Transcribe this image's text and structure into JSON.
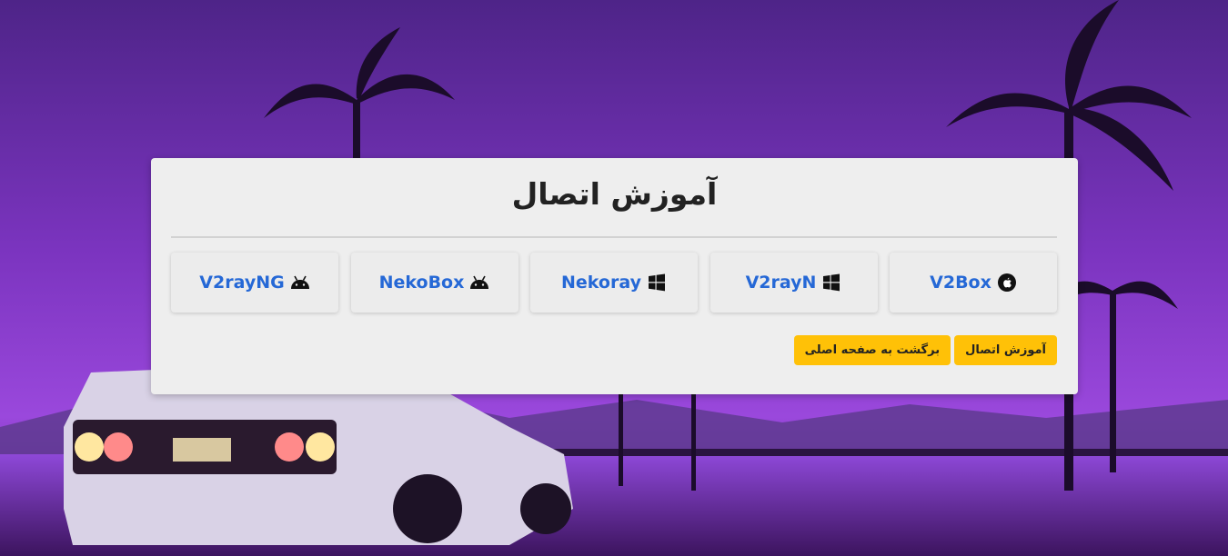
{
  "card": {
    "title": "آموزش اتصال"
  },
  "clients": [
    {
      "label": "V2Box",
      "icon": "apple-icon"
    },
    {
      "label": "V2rayN",
      "icon": "windows-icon"
    },
    {
      "label": "Nekoray",
      "icon": "windows-icon"
    },
    {
      "label": "NekoBox",
      "icon": "android-icon"
    },
    {
      "label": "V2rayNG",
      "icon": "android-icon"
    }
  ],
  "buttons": {
    "tutorial_label": "آموزش اتصال",
    "back_label": "برگشت به صفحه اصلی"
  },
  "colors": {
    "link": "#2568d6",
    "button": "#ffc107",
    "card": "#eeeeee"
  }
}
